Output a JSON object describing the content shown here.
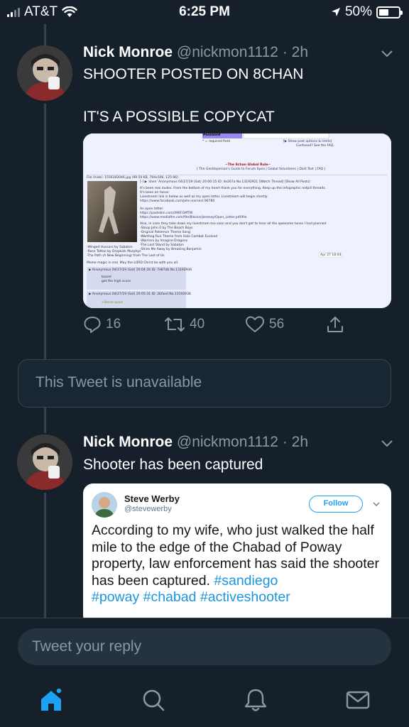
{
  "status_bar": {
    "carrier": "AT&T",
    "time": "6:25 PM",
    "battery_percent": "50%",
    "battery_level": 0.5
  },
  "tweet1": {
    "name": "Nick Monroe",
    "handle": "@nickmon1112 · 2h",
    "text": "SHOOTER POSTED ON 8CHAN\n\nIT'S A POSSIBLE COPYCAT",
    "media_description_icon": "8chan-thread-screenshot",
    "replies": "16",
    "retweets": "40",
    "likes": "56"
  },
  "unavailable": {
    "text": "This Tweet is unavailable"
  },
  "tweet2": {
    "name": "Nick Monroe",
    "handle": "@nickmon1112 · 2h",
    "text": "Shooter has been captured",
    "quote": {
      "name": "Steve Werby",
      "handle": "@stevewerby",
      "follow_label": "Follow",
      "text_plain": "According to my wife, who just walked the half mile to the edge of the Chabad of Poway property, law enforcement has said the shooter has been captured. ",
      "hashtags": [
        "#sandiego",
        "#poway",
        "#chabad",
        "#activeshooter"
      ]
    }
  },
  "reply": {
    "placeholder": "Tweet your reply"
  },
  "tabs": [
    "home-icon",
    "search-icon",
    "notifications-icon",
    "messages-icon"
  ],
  "colors": {
    "background": "#15202b",
    "accent": "#1da1f2",
    "muted": "#8899a6"
  }
}
